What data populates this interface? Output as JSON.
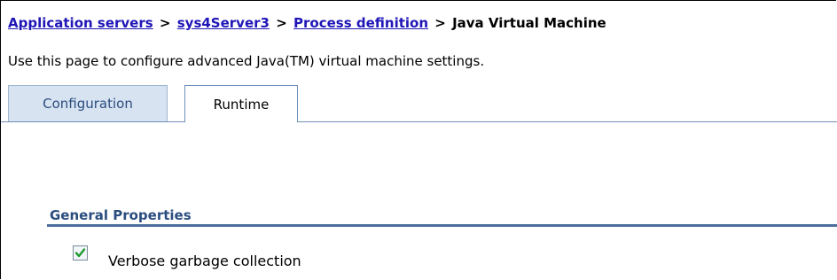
{
  "breadcrumb": {
    "items": [
      "Application servers",
      "sys4Server3",
      "Process definition"
    ],
    "separator": ">",
    "current": "Java Virtual Machine"
  },
  "page": {
    "description": "Use this page to configure advanced Java(TM) virtual machine settings."
  },
  "tabs": [
    {
      "label": "Configuration",
      "active": false
    },
    {
      "label": "Runtime",
      "active": true
    }
  ],
  "general_properties": {
    "title": "General Properties",
    "verbose_gc": {
      "label": "Verbose garbage collection",
      "checked": true
    }
  },
  "colors": {
    "link": "#1f16b7",
    "section_title": "#2a4d7f",
    "inactive_tab_bg": "#d8e3f1",
    "check": "#1f9a2d"
  }
}
